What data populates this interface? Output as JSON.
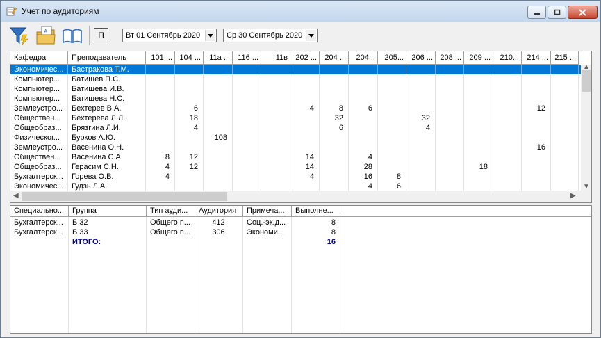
{
  "window": {
    "title": "Учет по аудиториям"
  },
  "toolbar": {
    "toggle_label": "П",
    "date_from": "Вт 01 Сентябрь 2020",
    "date_to": "Ср 30 Сентябрь 2020"
  },
  "top_grid": {
    "headers": [
      "Кафедра",
      "Преподаватель",
      "101 ...",
      "104 ...",
      "11а ...",
      "116 ...",
      "11в",
      "202 ...",
      "204 ...",
      "204...",
      "205...",
      "206 ...",
      "208 ...",
      "209 ...",
      "210...",
      "214 ...",
      "215 ..."
    ],
    "rows": [
      [
        "Экономичес...",
        "Бастракова Т.М.",
        "",
        "",
        "",
        "",
        "",
        "",
        "",
        "",
        "",
        "",
        "",
        "",
        "",
        "",
        ""
      ],
      [
        "Компьютер...",
        "Батищев П.С.",
        "",
        "",
        "",
        "",
        "",
        "",
        "",
        "",
        "",
        "",
        "",
        "",
        "",
        "",
        ""
      ],
      [
        "Компьютер...",
        "Батищева И.В.",
        "",
        "",
        "",
        "",
        "",
        "",
        "",
        "",
        "",
        "",
        "",
        "",
        "",
        "",
        ""
      ],
      [
        "Компьютер...",
        "Батищева Н.С.",
        "",
        "",
        "",
        "",
        "",
        "",
        "",
        "",
        "",
        "",
        "",
        "",
        "",
        "",
        ""
      ],
      [
        "Землеустро...",
        "Бехтерев В.А.",
        "",
        "6",
        "",
        "",
        "",
        "4",
        "8",
        "6",
        "",
        "",
        "",
        "",
        "",
        "12",
        ""
      ],
      [
        "Обществен...",
        "Бехтерева Л.Л.",
        "",
        "18",
        "",
        "",
        "",
        "",
        "32",
        "",
        "",
        "32",
        "",
        "",
        "",
        "",
        ""
      ],
      [
        "Общеобраз...",
        "Брязгина Л.И.",
        "",
        "4",
        "",
        "",
        "",
        "",
        "6",
        "",
        "",
        "4",
        "",
        "",
        "",
        "",
        ""
      ],
      [
        "Физическог...",
        "Бурков А.Ю.",
        "",
        "",
        "108",
        "",
        "",
        "",
        "",
        "",
        "",
        "",
        "",
        "",
        "",
        "",
        ""
      ],
      [
        "Землеустро...",
        "Васенина О.Н.",
        "",
        "",
        "",
        "",
        "",
        "",
        "",
        "",
        "",
        "",
        "",
        "",
        "",
        "16",
        ""
      ],
      [
        "Обществен...",
        "Васенина С.А.",
        "8",
        "12",
        "",
        "",
        "",
        "14",
        "",
        "4",
        "",
        "",
        "",
        "",
        "",
        "",
        ""
      ],
      [
        "Общеобраз...",
        "Герасим С.Н.",
        "4",
        "12",
        "",
        "",
        "",
        "14",
        "",
        "28",
        "",
        "",
        "",
        "18",
        "",
        "",
        ""
      ],
      [
        "Бухгалтерск...",
        "Горева О.В.",
        "4",
        "",
        "",
        "",
        "",
        "4",
        "",
        "16",
        "8",
        "",
        "",
        "",
        "",
        "",
        ""
      ],
      [
        "Экономичес...",
        "Гудзь Л.А.",
        "",
        "",
        "",
        "",
        "",
        "",
        "",
        "4",
        "6",
        "",
        "",
        "",
        "",
        "",
        ""
      ]
    ]
  },
  "bottom_grid": {
    "headers": [
      "Специально...",
      "Группа",
      "Тип ауди...",
      "Аудитория",
      "Примеча...",
      "Выполне..."
    ],
    "rows": [
      [
        "Бухгалтерск...",
        "Б 32",
        "Общего п...",
        "412",
        "Соц.-эк.д...",
        "8"
      ],
      [
        "Бухгалтерск...",
        "Б 33",
        "Общего п...",
        "306",
        "Экономи...",
        "8"
      ]
    ],
    "total_label": "ИТОГО:",
    "total_value": "16"
  }
}
